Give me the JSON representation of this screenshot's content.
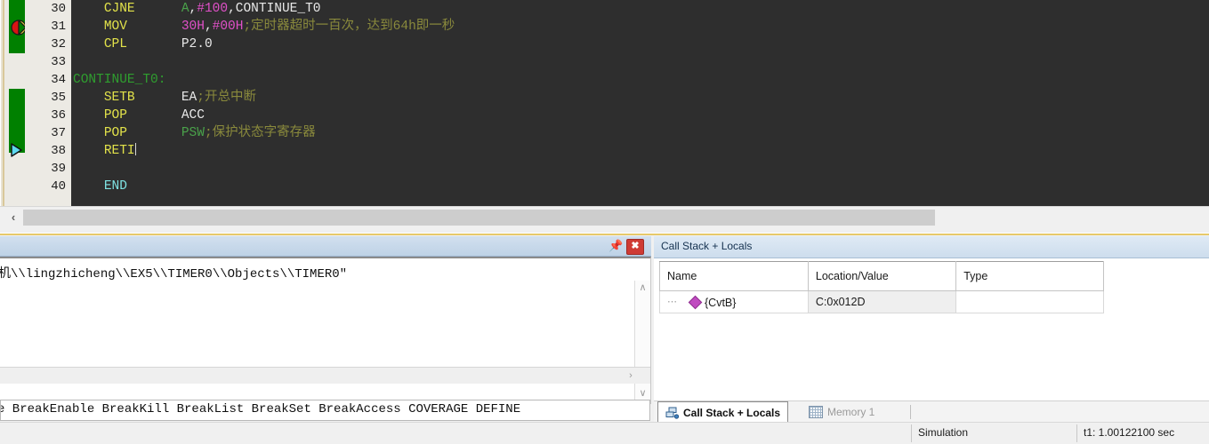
{
  "editor": {
    "gutter_markers": [
      {
        "name": "breakpoint-disabled-marker",
        "line": 31
      },
      {
        "name": "current-statement-arrow",
        "line": 38
      }
    ],
    "first_line_number": 30,
    "lines": [
      {
        "num": "30",
        "tokens": [
          {
            "t": "    ",
            "c": "plain"
          },
          {
            "t": "CJNE",
            "c": "mnemonic"
          },
          {
            "t": "      ",
            "c": "plain"
          },
          {
            "t": "A",
            "c": "symbol"
          },
          {
            "t": ",",
            "c": "plain"
          },
          {
            "t": "#100",
            "c": "number"
          },
          {
            "t": ",",
            "c": "plain"
          },
          {
            "t": "CONTINUE_T0",
            "c": "plain"
          }
        ]
      },
      {
        "num": "31",
        "tokens": [
          {
            "t": "    ",
            "c": "plain"
          },
          {
            "t": "MOV",
            "c": "mnemonic"
          },
          {
            "t": "       ",
            "c": "plain"
          },
          {
            "t": "30H",
            "c": "number"
          },
          {
            "t": ",",
            "c": "plain"
          },
          {
            "t": "#00H",
            "c": "number"
          },
          {
            "t": ";定时器超时一百次，达到64h即一秒",
            "c": "comment"
          }
        ]
      },
      {
        "num": "32",
        "tokens": [
          {
            "t": "    ",
            "c": "plain"
          },
          {
            "t": "CPL",
            "c": "mnemonic"
          },
          {
            "t": "       ",
            "c": "plain"
          },
          {
            "t": "P2.0",
            "c": "plain"
          }
        ]
      },
      {
        "num": "33",
        "tokens": []
      },
      {
        "num": "34",
        "tokens": [
          {
            "t": "CONTINUE_T0:",
            "c": "label"
          }
        ]
      },
      {
        "num": "35",
        "tokens": [
          {
            "t": "    ",
            "c": "plain"
          },
          {
            "t": "SETB",
            "c": "mnemonic"
          },
          {
            "t": "      ",
            "c": "plain"
          },
          {
            "t": "EA",
            "c": "plain"
          },
          {
            "t": ";开总中断",
            "c": "comment"
          }
        ]
      },
      {
        "num": "36",
        "tokens": [
          {
            "t": "    ",
            "c": "plain"
          },
          {
            "t": "POP",
            "c": "mnemonic"
          },
          {
            "t": "       ",
            "c": "plain"
          },
          {
            "t": "ACC",
            "c": "plain"
          }
        ]
      },
      {
        "num": "37",
        "tokens": [
          {
            "t": "    ",
            "c": "plain"
          },
          {
            "t": "POP",
            "c": "mnemonic"
          },
          {
            "t": "       ",
            "c": "plain"
          },
          {
            "t": "PSW",
            "c": "symbol"
          },
          {
            "t": ";保护状态字寄存器",
            "c": "comment"
          }
        ]
      },
      {
        "num": "38",
        "tokens": [
          {
            "t": "    ",
            "c": "plain"
          },
          {
            "t": "RETI",
            "c": "mnemonic"
          }
        ],
        "caret": true
      },
      {
        "num": "39",
        "tokens": []
      },
      {
        "num": "40",
        "tokens": [
          {
            "t": "    ",
            "c": "plain"
          },
          {
            "t": "END",
            "c": "directive"
          }
        ]
      }
    ],
    "colors": {
      "background": "#2e2e2e",
      "gutter": "#eceae4",
      "gutter_executed": "#008000",
      "mnemonic": "#e2e24a",
      "number": "#e050c8",
      "comment": "#8a8a3c",
      "label": "#2f9e2f",
      "symbol": "#4aa24a",
      "directive": "#7fe3e3",
      "plain": "#e8e8e8"
    }
  },
  "build_panel": {
    "pin_icon": "pin-icon",
    "close_icon": "close-icon",
    "output_text": "机\\\\lingzhicheng\\\\EX5\\\\TIMER0\\\\Objects\\\\TIMER0\"",
    "scroll_up_icon": "chevron-up-icon",
    "scroll_down_icon": "chevron-down-icon",
    "scroll_right_icon": "chevron-right-icon",
    "command_text": "e BreakEnable BreakKill BreakList BreakSet BreakAccess COVERAGE DEFINE"
  },
  "call_stack_panel": {
    "title": "Call Stack + Locals",
    "columns": [
      "Name",
      "Location/Value",
      "Type"
    ],
    "rows": [
      {
        "name": "{CvtB}",
        "location": "C:0x012D",
        "type": ""
      }
    ]
  },
  "tabs": [
    {
      "label": "Call Stack + Locals",
      "icon": "call-stack-icon",
      "active": true
    },
    {
      "label": "Memory 1",
      "icon": "memory-grid-icon",
      "active": false
    }
  ],
  "status_bar": {
    "mode": "Simulation",
    "timer": "t1: 1.00122100 sec"
  }
}
